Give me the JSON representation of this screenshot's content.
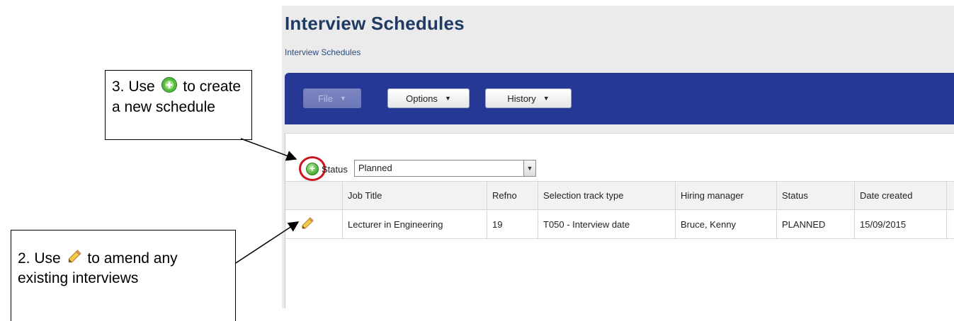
{
  "app": {
    "title": "Interview Schedules",
    "breadcrumb": "Interview Schedules"
  },
  "toolbar": {
    "file_label": "File",
    "options_label": "Options",
    "history_label": "History",
    "caret": "▼",
    "bar_color": "#253896"
  },
  "filter": {
    "status_label": "Status",
    "status_value": "Planned",
    "arrow": "▼"
  },
  "table": {
    "columns": [
      "",
      "Job Title",
      "Refno",
      "Selection track type",
      "Hiring manager",
      "Status",
      "Date created"
    ],
    "rows": [
      {
        "icon": "pencil-icon",
        "job_title": "Lecturer in Engineering",
        "refno": "19",
        "selection_track_type": "T050 - Interview date",
        "hiring_manager": "Bruce, Kenny",
        "status": "PLANNED",
        "date_created": "15/09/2015"
      }
    ]
  },
  "callouts": {
    "create": {
      "text_before": "3. Use",
      "text_after": "to create a new schedule",
      "icon": "add-icon"
    },
    "amend": {
      "text_before": "2. Use",
      "text_after": "to amend any existing interviews",
      "icon": "pencil-icon"
    }
  },
  "colors": {
    "accent_ring": "#c8171e",
    "add_green": "#4fb13a",
    "title_blue": "#1f3a63"
  }
}
